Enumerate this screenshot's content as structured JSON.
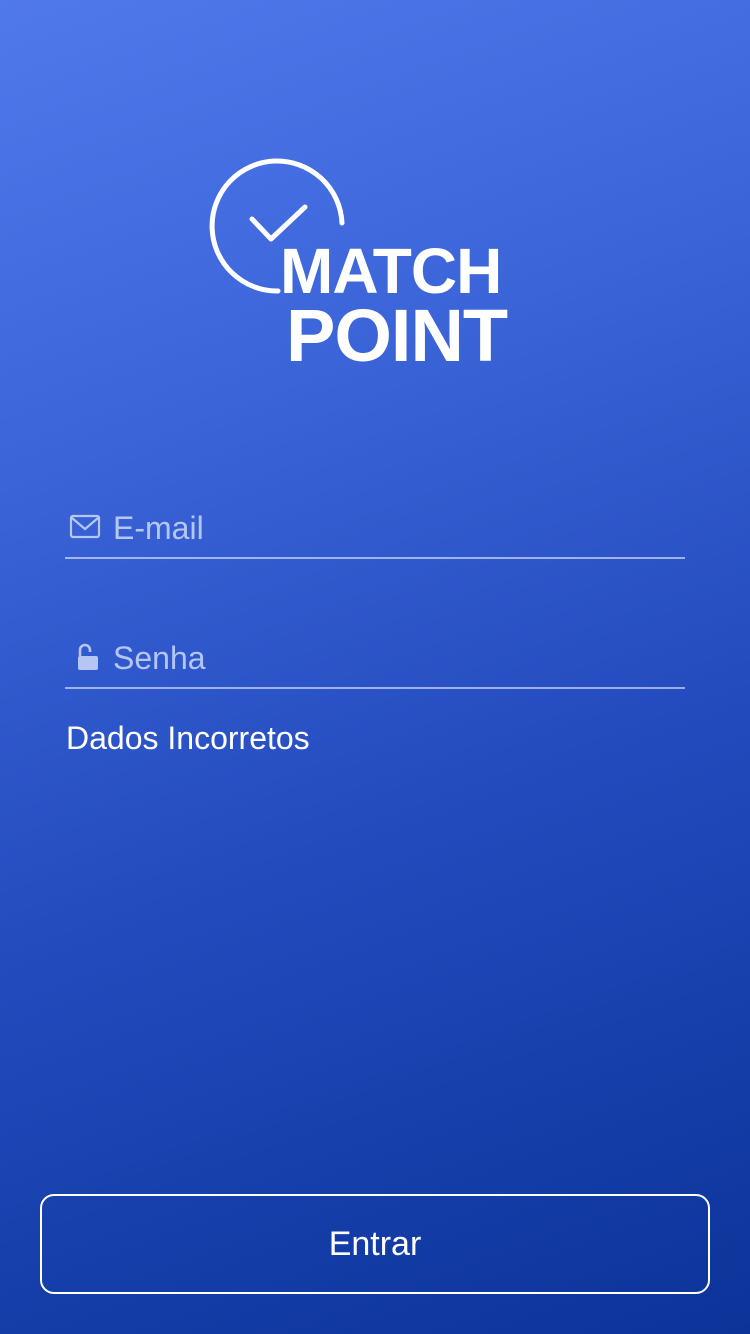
{
  "logo": {
    "line1": "MATCH",
    "line2": "POINT",
    "icon": "circle-check-icon"
  },
  "form": {
    "email": {
      "placeholder": "E-mail",
      "value": "",
      "icon": "envelope-icon"
    },
    "password": {
      "placeholder": "Senha",
      "value": "",
      "icon": "unlocked-padlock-icon"
    },
    "error_message": "Dados Incorretos"
  },
  "actions": {
    "submit_label": "Entrar"
  },
  "colors": {
    "gradient_top": "#5079EC",
    "gradient_bottom": "#0B3398",
    "text": "#FFFFFF",
    "placeholder": "#CDD8FA"
  }
}
